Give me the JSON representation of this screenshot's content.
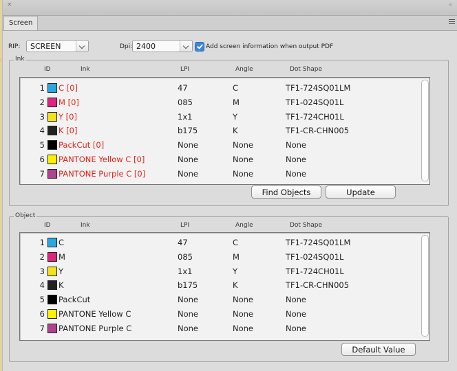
{
  "panel": {
    "tab_label": "Screen",
    "close_glyph": "×",
    "collapse_glyph": "«",
    "menu_icon": "hamburger-menu-icon"
  },
  "toolbar": {
    "rip_label": "RIP:",
    "rip_value": "SCREEN",
    "dpi_label": "Dpi:",
    "dpi_value": "2400",
    "add_info_checked": true,
    "add_info_label": "Add screen information when output PDF"
  },
  "ink_group": {
    "legend": "Ink",
    "headers": {
      "id": "ID",
      "ink": "Ink",
      "lpi": "LPI",
      "angle": "Angle",
      "dot": "Dot Shape"
    },
    "rows": [
      {
        "id": "1",
        "color": "#2aa7e2",
        "name": "C [0]",
        "lpi": "47",
        "angle": "C",
        "dot": "TF1-724SQ01LM"
      },
      {
        "id": "2",
        "color": "#e0237e",
        "name": "M [0]",
        "lpi": "085",
        "angle": "M",
        "dot": "TF1-024SQ01L"
      },
      {
        "id": "3",
        "color": "#f6e21b",
        "name": "Y [0]",
        "lpi": "1x1",
        "angle": "Y",
        "dot": "TF1-724CH01L"
      },
      {
        "id": "4",
        "color": "#222222",
        "name": "K [0]",
        "lpi": "b175",
        "angle": "K",
        "dot": "TF1-CR-CHN005"
      },
      {
        "id": "5",
        "color": "#000000",
        "name": "PackCut [0]",
        "lpi": "None",
        "angle": "None",
        "dot": "None"
      },
      {
        "id": "6",
        "color": "#fff200",
        "name": "PANTONE Yellow C [0]",
        "lpi": "None",
        "angle": "None",
        "dot": "None"
      },
      {
        "id": "7",
        "color": "#b0428f",
        "name": "PANTONE Purple C [0]",
        "lpi": "None",
        "angle": "None",
        "dot": "None"
      }
    ],
    "find_button": "Find Objects",
    "update_button": "Update"
  },
  "object_group": {
    "legend": "Object",
    "headers": {
      "id": "ID",
      "ink": "Ink",
      "lpi": "LPI",
      "angle": "Angle",
      "dot": "Dot Shape"
    },
    "rows": [
      {
        "id": "1",
        "color": "#2aa7e2",
        "name": "C",
        "lpi": "47",
        "angle": "C",
        "dot": "TF1-724SQ01LM"
      },
      {
        "id": "2",
        "color": "#e0237e",
        "name": "M",
        "lpi": "085",
        "angle": "M",
        "dot": "TF1-024SQ01L"
      },
      {
        "id": "3",
        "color": "#f6e21b",
        "name": "Y",
        "lpi": "1x1",
        "angle": "Y",
        "dot": "TF1-724CH01L"
      },
      {
        "id": "4",
        "color": "#222222",
        "name": "K",
        "lpi": "b175",
        "angle": "K",
        "dot": "TF1-CR-CHN005"
      },
      {
        "id": "5",
        "color": "#000000",
        "name": "PackCut",
        "lpi": "None",
        "angle": "None",
        "dot": "None"
      },
      {
        "id": "6",
        "color": "#fff200",
        "name": "PANTONE Yellow C",
        "lpi": "None",
        "angle": "None",
        "dot": "None"
      },
      {
        "id": "7",
        "color": "#b0428f",
        "name": "PANTONE Purple C",
        "lpi": "None",
        "angle": "None",
        "dot": "None"
      }
    ],
    "default_button": "Default Value"
  },
  "colors": {
    "ink_name_red": "#e6231c",
    "checkbox_blue": "#3b86d8",
    "backdrop": "#e8d29b"
  }
}
